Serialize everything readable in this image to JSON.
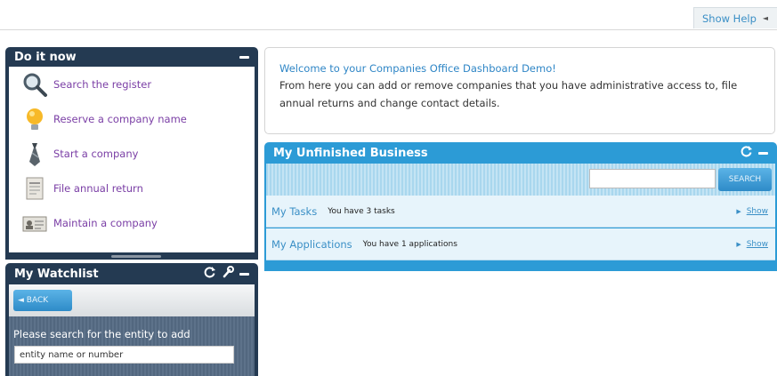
{
  "help": {
    "label": "Show Help",
    "arrow": "◄"
  },
  "do_it_now": {
    "title": "Do it now",
    "actions": [
      {
        "label": "Search the register",
        "icon": "magnifier-icon"
      },
      {
        "label": "Reserve a company name",
        "icon": "lightbulb-icon"
      },
      {
        "label": "Start a company",
        "icon": "necktie-icon"
      },
      {
        "label": "File annual return",
        "icon": "document-icon"
      },
      {
        "label": "Maintain a company",
        "icon": "id-card-icon"
      }
    ]
  },
  "watchlist": {
    "title": "My Watchlist",
    "back_label": "◄ BACK",
    "search_label": "Please search for the entity to add",
    "search_value": "entity name or number"
  },
  "welcome": {
    "title": "Welcome to your Companies Office Dashboard Demo!",
    "text": "From here you can add or remove companies that you have administrative access to, file annual returns and change contact details."
  },
  "business": {
    "title": "My Unfinished Business",
    "search_button": "SEARCH",
    "rows": [
      {
        "label": "My Tasks",
        "detail": "You have 3 tasks",
        "action": "Show"
      },
      {
        "label": "My Applications",
        "detail": "You have 1 applications",
        "action": "Show"
      }
    ]
  },
  "colors": {
    "panel_dark": "#243a52",
    "panel_blue": "#2c9bd6",
    "link": "#3a8fc6",
    "action_link": "#7a3ea5"
  }
}
